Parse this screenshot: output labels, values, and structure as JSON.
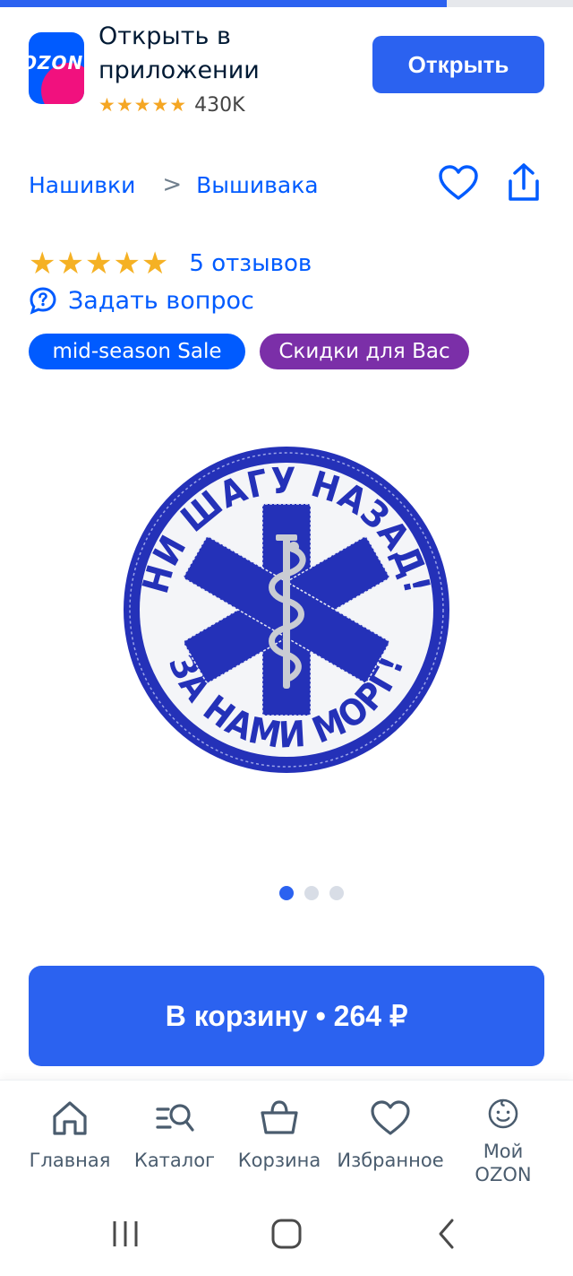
{
  "page_load": {
    "progress_percent": 78
  },
  "app_banner": {
    "logo_text": "OZON",
    "title": "Открыть в приложении",
    "stars": "★★★★★",
    "rating_count": "430K",
    "open_button": "Открыть"
  },
  "breadcrumb": {
    "items": [
      "Нашивки",
      "Вышивака"
    ],
    "separator": ">"
  },
  "rating": {
    "stars": "★★★★★",
    "reviews": "5 отзывов",
    "ask_question": "Задать вопрос"
  },
  "badges": {
    "sale": "mid-season Sale",
    "discounts": "Скидки для Вас"
  },
  "product": {
    "patch_text_top": "НИ ШАГУ НАЗАД!",
    "patch_text_bottom": "ЗА НАМИ МОРГ!",
    "colors": {
      "blue": "#2431b8",
      "white": "#f4f5f8",
      "silver": "#c9ccd3"
    }
  },
  "carousel": {
    "count": 3,
    "active_index": 0
  },
  "cart": {
    "label": "В корзину • 264 ₽"
  },
  "bottom_nav": {
    "items": [
      {
        "label": "Главная",
        "icon": "home-icon"
      },
      {
        "label": "Каталог",
        "icon": "catalog-search-icon"
      },
      {
        "label": "Корзина",
        "icon": "basket-icon"
      },
      {
        "label": "Избранное",
        "icon": "heart-icon"
      },
      {
        "label": "Мой OZON",
        "icon": "smiley-icon"
      }
    ]
  },
  "system_nav": {
    "icons": [
      "recent-apps-icon",
      "home-button-icon",
      "back-icon"
    ]
  },
  "colors": {
    "accent": "#2b62f0",
    "link": "#005bff",
    "star": "#f5b124",
    "purple": "#7b2fa8"
  }
}
